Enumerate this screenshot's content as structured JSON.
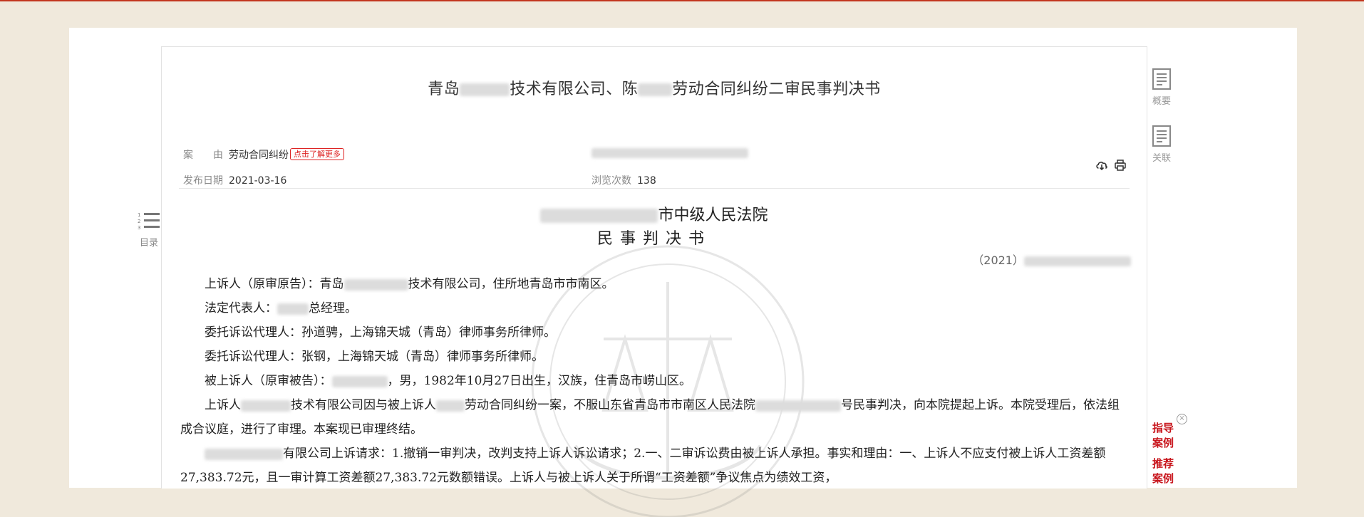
{
  "document": {
    "title_part1": "青岛",
    "title_part2": "技术有限公司、陈",
    "title_part3": "劳动合同纠纷二审民事判决书"
  },
  "meta": {
    "cause_label": "案　　由",
    "cause_value": "劳动合同纠纷",
    "learn_more": "点击了解更多",
    "publish_label": "发布日期",
    "publish_date": "2021-03-16",
    "views_label": "浏览次数",
    "views_count": "138"
  },
  "court": {
    "name_visible": "市中级人民法院",
    "doc_type": "民事判决书",
    "case_number_visible": "（2021）"
  },
  "paragraphs": {
    "p1a": "上诉人（原审原告）：青岛",
    "p1b": "技术有限公司，住所地青岛市市南区。",
    "p2a": "法定代表人：",
    "p2b": "总经理。",
    "p3": "委托诉讼代理人：孙道骋，上海锦天城（青岛）律师事务所律师。",
    "p4": "委托诉讼代理人：张钢，上海锦天城（青岛）律师事务所律师。",
    "p5a": "被上诉人（原审被告）：",
    "p5b": "，男，1982年10月27日出生，汉族，住青岛市崂山区。",
    "p6a": "上诉人",
    "p6b": "技术有限公司因与被上诉人",
    "p6c": "劳动合同纠纷一案，不服山东省青岛市市南区人民法院",
    "p6d": "号民事判决，向本院提起上诉。本院受理后，依法组成合议庭，进行了审理。本案现已审理终结。",
    "p7a": "有限公司上诉请求：1.撤销一审判决，改判支持上诉人诉讼请求；2.一、二审诉讼费由被上诉人承担。事实和理由：一、上诉人不应支付被上诉人工资差额27,383.72元，且一审计算工资差额27,383.72元数额错误。上诉人与被上诉人关于所谓“工资差额”争议焦点为绩效工资，"
  },
  "sidebar": {
    "toc_label": "目录",
    "summary_label": "概要",
    "related_label": "关联",
    "guide_cases": "指导案例",
    "recommended_cases": "推荐案例",
    "close_symbol": "×"
  },
  "colors": {
    "accent_red": "#c8161d",
    "background": "#f0e9dc"
  }
}
